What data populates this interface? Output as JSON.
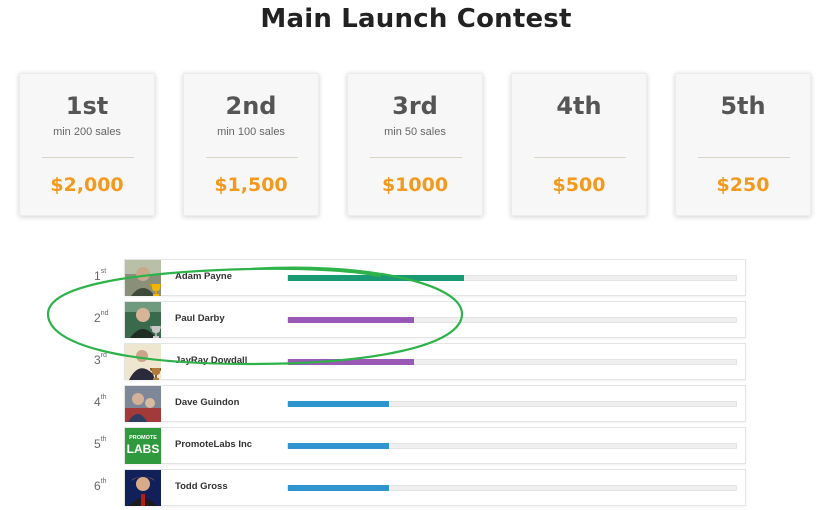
{
  "page": {
    "title": "Main Launch Contest"
  },
  "prizes": [
    {
      "rank": "1st",
      "min": "min 200 sales",
      "amount": "$2,000"
    },
    {
      "rank": "2nd",
      "min": "min 100 sales",
      "amount": "$1,500"
    },
    {
      "rank": "3rd",
      "min": "min 50 sales",
      "amount": "$1000"
    },
    {
      "rank": "4th",
      "min": "",
      "amount": "$500"
    },
    {
      "rank": "5th",
      "min": "",
      "amount": "$250"
    }
  ],
  "leaderboard": [
    {
      "num": "1",
      "suffix": "st",
      "name": "Adam Payne",
      "progress": 0.39,
      "bar_color": "#1a9a74",
      "avatar": "photo-avatar",
      "trophy": "gold-trophy-icon"
    },
    {
      "num": "2",
      "suffix": "nd",
      "name": "Paul Darby",
      "progress": 0.28,
      "bar_color": "#9b59b6",
      "avatar": "photo-avatar",
      "trophy": "silver-trophy-icon"
    },
    {
      "num": "3",
      "suffix": "rd",
      "name": "JayRay Dowdall",
      "progress": 0.28,
      "bar_color": "#9b59b6",
      "avatar": "photo-avatar",
      "trophy": "bronze-trophy-icon"
    },
    {
      "num": "4",
      "suffix": "th",
      "name": "Dave Guindon",
      "progress": 0.225,
      "bar_color": "#2f95d1",
      "avatar": "photo-avatar",
      "trophy": ""
    },
    {
      "num": "5",
      "suffix": "th",
      "name": "PromoteLabs Inc",
      "progress": 0.225,
      "bar_color": "#2f95d1",
      "avatar": "promotelabs-logo",
      "trophy": ""
    },
    {
      "num": "6",
      "suffix": "th",
      "name": "Todd Gross",
      "progress": 0.225,
      "bar_color": "#2f95d1",
      "avatar": "photo-avatar",
      "trophy": ""
    }
  ],
  "promotelabs_logo": {
    "line1": "PROMOTE",
    "line2": "LABS"
  },
  "annotation": {
    "color": "#2db34a",
    "icon": "hand-drawn-ellipse"
  }
}
